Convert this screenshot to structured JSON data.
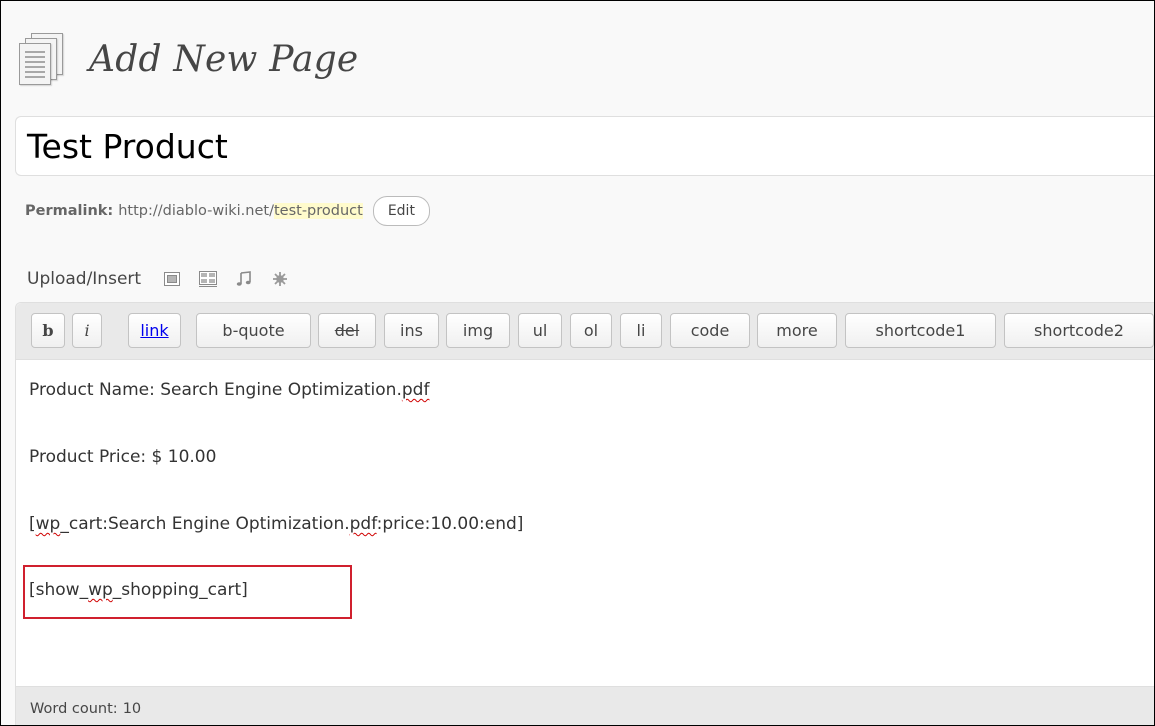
{
  "header": {
    "title": "Add New Page",
    "icon": "pages-icon"
  },
  "title_field": {
    "value": "Test Product"
  },
  "permalink": {
    "label": "Permalink:",
    "base": "http://diablo-wiki.net/",
    "slug": "test-product",
    "edit_label": "Edit"
  },
  "upload": {
    "label": "Upload/Insert",
    "icons": [
      "add-image-icon",
      "add-video-icon",
      "add-audio-icon",
      "add-media-icon"
    ]
  },
  "quicktags": [
    {
      "label": "b",
      "name": "bold"
    },
    {
      "label": "i",
      "name": "italic"
    },
    {
      "label": "link",
      "name": "link"
    },
    {
      "label": "b-quote",
      "name": "b-quote"
    },
    {
      "label": "del",
      "name": "del"
    },
    {
      "label": "ins",
      "name": "ins"
    },
    {
      "label": "img",
      "name": "img"
    },
    {
      "label": "ul",
      "name": "ul"
    },
    {
      "label": "ol",
      "name": "ol"
    },
    {
      "label": "li",
      "name": "li"
    },
    {
      "label": "code",
      "name": "code"
    },
    {
      "label": "more",
      "name": "more"
    },
    {
      "label": "shortcode1",
      "name": "shortcode1"
    },
    {
      "label": "shortcode2",
      "name": "shortcode2"
    }
  ],
  "content": {
    "line1_prefix": "Product Name:  Search Engine Optimization.",
    "line1_spell": "pdf",
    "line2": "Product Price: $ 10.00",
    "line3_open": "[",
    "line3_spell1": "wp",
    "line3_mid": "_cart:Search Engine Optimization.",
    "line3_spell2": "pdf",
    "line3_end": ":price:10.00:end]",
    "line4_open": "[show_",
    "line4_spell": "wp",
    "line4_end": "_shopping_cart]"
  },
  "status": {
    "word_count_label": "Word count:",
    "word_count": "10"
  },
  "colors": {
    "highlight_border": "#d0202e",
    "slug_highlight": "#fffbcc",
    "spellcheck": "#d00000"
  }
}
